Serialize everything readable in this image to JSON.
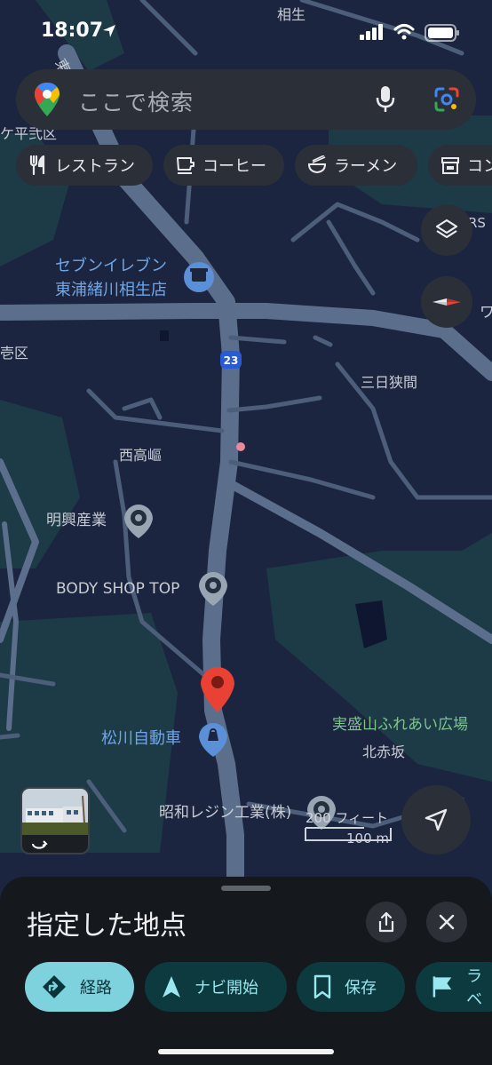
{
  "status_bar": {
    "time": "18:07"
  },
  "search": {
    "placeholder": "ここで検索"
  },
  "chips": [
    {
      "label": "レストラン",
      "icon": "fork-knife-icon"
    },
    {
      "label": "コーヒー",
      "icon": "coffee-icon"
    },
    {
      "label": "ラーメン",
      "icon": "ramen-icon"
    },
    {
      "label": "コン",
      "icon": "store-icon"
    }
  ],
  "map": {
    "labels": {
      "aioi": "相生",
      "higashiura": "東浦",
      "taira": "ケ平弐区",
      "seven_1": "セブンイレブン",
      "seven_2": "東浦緒川相生店",
      "route": "23",
      "ichi": "壱区",
      "mikkahazama": "三日狭間",
      "nishitakane": "西高嶇",
      "meiko": "明興産業",
      "bodyshop": "BODY SHOP TOP",
      "matsukawa": "松川自動車",
      "jissei_1": "実盛山ふれあい広場",
      "kitaakasaka": "北赤坂",
      "showa": "昭和レジン工業(株)",
      "wa": "ワ",
      "rs": "RS"
    },
    "scale": {
      "feet": "200 フィート",
      "meters": "100 m"
    },
    "colors": {
      "land": "#1b2540",
      "park": "#1d3a47",
      "road": "#5b6f8c",
      "pin": "#e94235"
    }
  },
  "sheet": {
    "title": "指定した地点",
    "actions": [
      {
        "label": "経路",
        "icon": "directions-icon"
      },
      {
        "label": "ナビ開始",
        "icon": "navigation-icon"
      },
      {
        "label": "保存",
        "icon": "bookmark-icon"
      },
      {
        "label": "ラベ",
        "icon": "flag-icon"
      }
    ]
  }
}
